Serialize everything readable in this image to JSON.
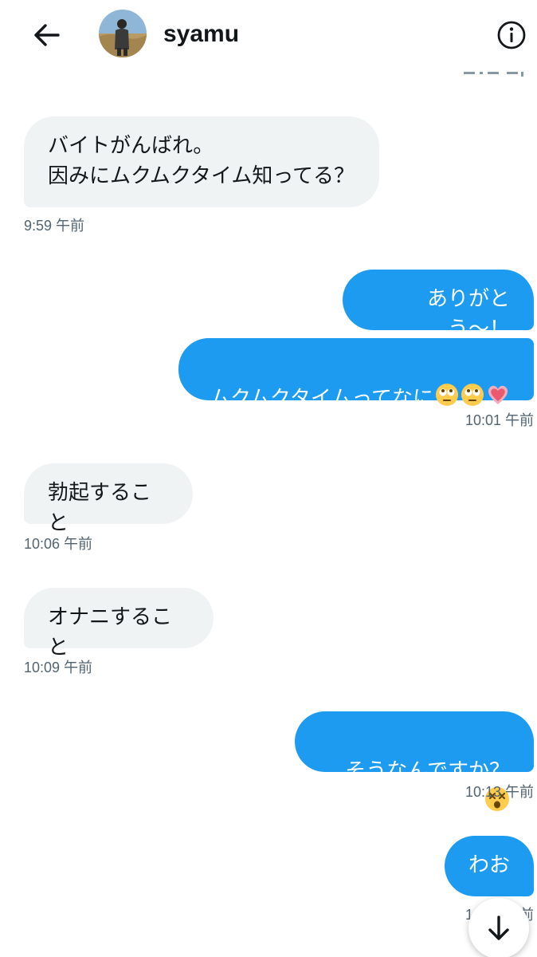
{
  "header": {
    "contact_name": "syamu",
    "back_icon": "arrow-left-icon",
    "info_icon": "info-circle-icon"
  },
  "colors": {
    "outgoing_bubble": "#1d9bf0",
    "incoming_bubble": "#eff3f4",
    "timestamp": "#536471"
  },
  "messages": [
    {
      "direction": "in",
      "text": "バイトがんばれ。\n因みにムクムクタイム知ってる？",
      "time": "9:59 午前"
    },
    {
      "direction": "out",
      "text": "ありがとう〜！"
    },
    {
      "direction": "out",
      "text": "ムクムクタイムってなに",
      "emoji": [
        "face-with-rolling-eyes",
        "face-with-rolling-eyes",
        "growing-heart"
      ],
      "time": "10:01 午前"
    },
    {
      "direction": "in",
      "text": "勃起すること",
      "time": "10:06 午前"
    },
    {
      "direction": "in",
      "text": "オナニすること",
      "time": "10:09 午前"
    },
    {
      "direction": "out",
      "text": "そうなんですか？",
      "emoji": [
        "dizzy-face"
      ],
      "time": "10:13 午前"
    },
    {
      "direction": "out",
      "text": "わお",
      "time": "10:14 午前"
    }
  ],
  "scroll_button_icon": "arrow-down-icon"
}
